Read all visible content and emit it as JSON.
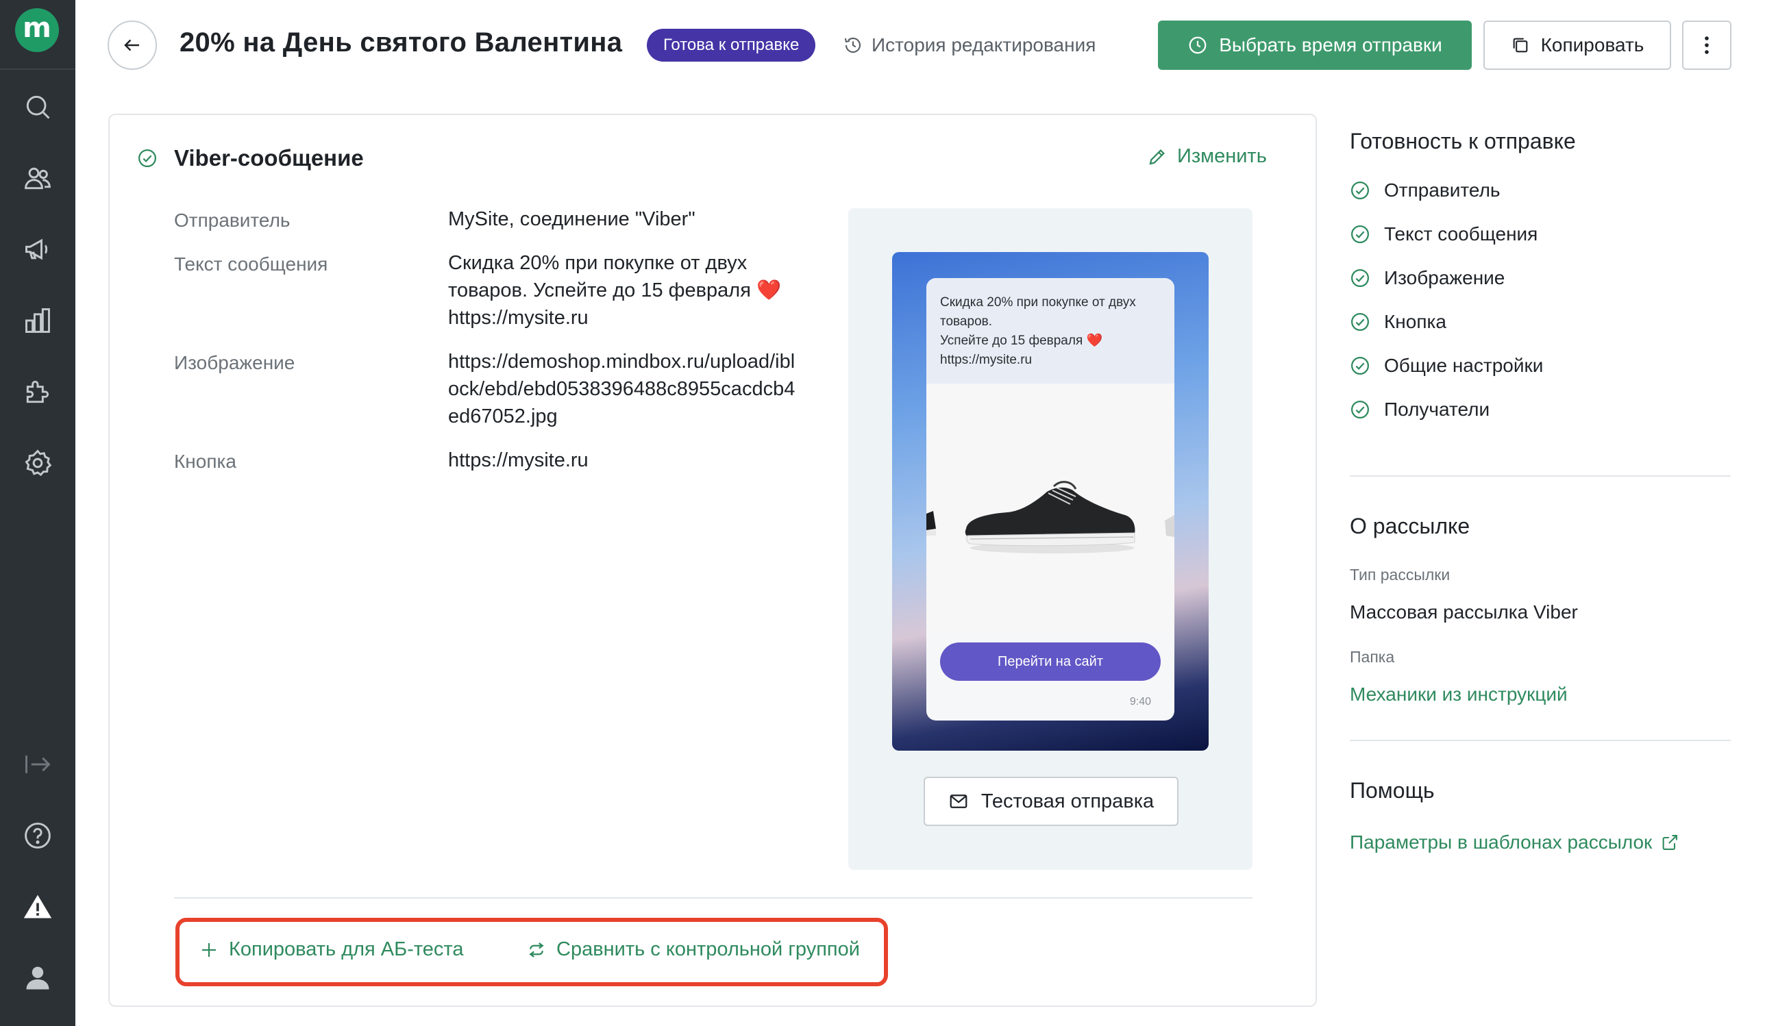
{
  "sidebar": {
    "logo_letter": "m",
    "icons": [
      "search-icon",
      "users-icon",
      "megaphone-icon",
      "analytics-icon",
      "integrations-icon",
      "settings-icon",
      "collapse-icon",
      "help-icon",
      "alert-icon",
      "profile-icon"
    ]
  },
  "header": {
    "title": "20% на День святого Валентина",
    "status": "Готова к отправке",
    "history": "История редактирования",
    "schedule_button": "Выбрать время отправки",
    "copy_button": "Копировать"
  },
  "card": {
    "title": "Viber-сообщение",
    "edit": "Изменить",
    "fields": [
      {
        "label": "Отправитель",
        "value": "MySite, соединение \"Viber\""
      },
      {
        "label": "Текст сообщения",
        "value": "Скидка 20% при покупке от двух товаров. Успейте до 15 февраля ❤️ https://mysite.ru"
      },
      {
        "label": "Изображение",
        "value": "https://demoshop.mindbox.ru/upload/iblock/ebd/ebd0538396488c8955cacdcb4ed67052.jpg"
      },
      {
        "label": "Кнопка",
        "value": "https://mysite.ru"
      }
    ],
    "preview": {
      "message_line1": "Скидка 20% при покупке от двух товаров.",
      "message_line2": "Успейте до 15 февраля ❤️",
      "message_line3": "https://mysite.ru",
      "button": "Перейти на сайт",
      "time": "9:40"
    },
    "test_send": "Тестовая отправка",
    "ab_copy": "Копировать для АБ-теста",
    "control_group": "Сравнить с контрольной группой"
  },
  "readiness": {
    "title": "Готовность к отправке",
    "items": [
      "Отправитель",
      "Текст сообщения",
      "Изображение",
      "Кнопка",
      "Общие настройки",
      "Получатели"
    ]
  },
  "about": {
    "title": "О рассылке",
    "type_label": "Тип рассылки",
    "type_value": "Массовая рассылка Viber",
    "folder_label": "Папка",
    "folder_value": "Механики из инструкций"
  },
  "help": {
    "title": "Помощь",
    "link": "Параметры в шаблонах рассылок"
  },
  "colors": {
    "accent": "#3e9a6d",
    "status_badge": "#4534a6",
    "highlight": "#e8412c",
    "sidebar": "#2c3136"
  }
}
